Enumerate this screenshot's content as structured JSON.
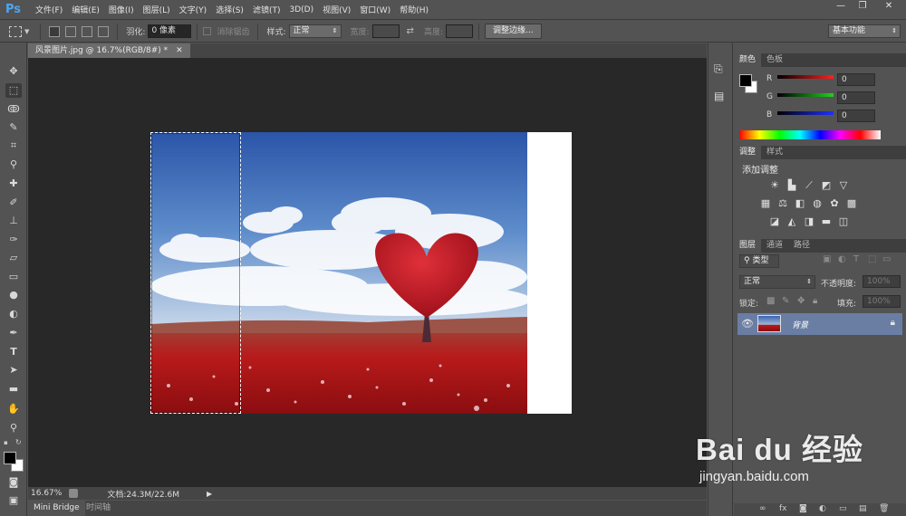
{
  "app": {
    "logo": "Ps",
    "menu": [
      "文件(F)",
      "编辑(E)",
      "图像(I)",
      "图层(L)",
      "文字(Y)",
      "选择(S)",
      "滤镜(T)",
      "3D(D)",
      "视图(V)",
      "窗口(W)",
      "帮助(H)"
    ]
  },
  "options": {
    "feather_label": "羽化:",
    "feather_value": "0 像素",
    "antialias_label": "消除锯齿",
    "style_label": "样式:",
    "style_value": "正常",
    "width_label": "宽度:",
    "height_label": "高度:",
    "refine_edge_button": "调整边缘...",
    "workspace_value": "基本功能"
  },
  "document": {
    "tab_title": "风景图片.jpg @ 16.7%(RGB/8#) *",
    "zoom": "16.67%",
    "doc_size": "文档:24.3M/22.6M"
  },
  "bottom_tabs": [
    "Mini Bridge",
    "时间轴"
  ],
  "color_panel": {
    "tabs": [
      "颜色",
      "色板"
    ],
    "channels": [
      {
        "label": "R",
        "value": "0",
        "color": "#e02020"
      },
      {
        "label": "G",
        "value": "0",
        "color": "#20c020"
      },
      {
        "label": "B",
        "value": "0",
        "color": "#2020e0"
      }
    ]
  },
  "adjustments_panel": {
    "tabs": [
      "调整",
      "样式"
    ],
    "heading": "添加调整"
  },
  "layers_panel": {
    "tabs": [
      "图层",
      "通道",
      "路径"
    ],
    "filter_kind": "类型",
    "blend_mode": "正常",
    "opacity_label": "不透明度:",
    "opacity_value": "100%",
    "lock_label": "锁定:",
    "fill_label": "填充:",
    "fill_value": "100%",
    "layers": [
      {
        "name": "背景",
        "locked": true,
        "visible": true
      }
    ]
  },
  "watermark": {
    "brand": "Bai du 经验",
    "url": "jingyan.baidu.com"
  },
  "colors": {
    "accent_blue": "#4ea5f2",
    "selected_layer": "#6a7ea4"
  }
}
